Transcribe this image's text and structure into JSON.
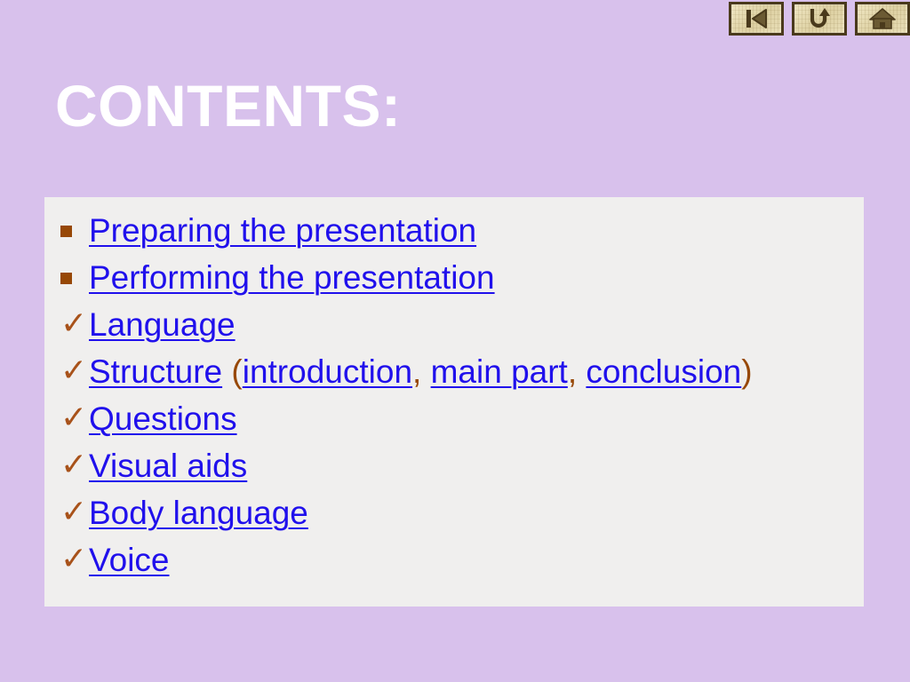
{
  "slide": {
    "title": "CONTENTS:",
    "background_color": "#d8c1ec",
    "panel_color": "#f0efee",
    "link_color": "#2010ec",
    "bullet_color": "#974806"
  },
  "nav": {
    "buttons": [
      {
        "name": "previous-slide-button",
        "icon": "skip-back-icon",
        "label": "Previous"
      },
      {
        "name": "return-button",
        "icon": "u-turn-arrow-icon",
        "label": "Return"
      },
      {
        "name": "home-button",
        "icon": "home-icon",
        "label": "Home"
      }
    ]
  },
  "contents": {
    "items": [
      {
        "bullet": "square",
        "parts": [
          {
            "text": "Preparing the presentation",
            "link": true
          }
        ]
      },
      {
        "bullet": "square",
        "parts": [
          {
            "text": "Performing the presentation",
            "link": true
          }
        ]
      },
      {
        "bullet": "check",
        "parts": [
          {
            "text": "Language",
            "link": true
          }
        ]
      },
      {
        "bullet": "check",
        "parts": [
          {
            "text": "Structure",
            "link": true
          },
          {
            "text": " (",
            "link": false
          },
          {
            "text": "introduction",
            "link": true
          },
          {
            "text": ", ",
            "link": false
          },
          {
            "text": "main part",
            "link": true
          },
          {
            "text": ", ",
            "link": false
          },
          {
            "text": "conclusion",
            "link": true
          },
          {
            "text": ")",
            "link": false
          }
        ]
      },
      {
        "bullet": "check",
        "parts": [
          {
            "text": "Questions",
            "link": true
          }
        ]
      },
      {
        "bullet": "check",
        "parts": [
          {
            "text": "Visual aids",
            "link": true
          }
        ]
      },
      {
        "bullet": "check",
        "parts": [
          {
            "text": "Body language",
            "link": true
          }
        ]
      },
      {
        "bullet": "check",
        "parts": [
          {
            "text": "Voice",
            "link": true
          }
        ]
      }
    ],
    "check_glyph": "✓"
  }
}
